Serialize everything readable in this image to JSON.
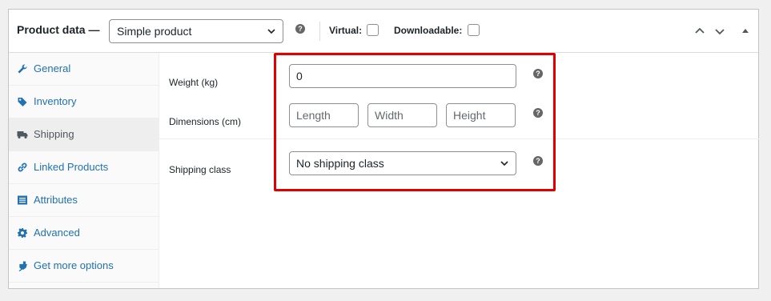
{
  "header": {
    "title": "Product data —",
    "product_type": "Simple product",
    "virtual_label": "Virtual:",
    "downloadable_label": "Downloadable:"
  },
  "help_icon_glyph": "?",
  "tabs": [
    {
      "label": "General",
      "icon": "wrench-icon"
    },
    {
      "label": "Inventory",
      "icon": "tag-icon"
    },
    {
      "label": "Shipping",
      "icon": "truck-icon",
      "active": true
    },
    {
      "label": "Linked Products",
      "icon": "link-icon"
    },
    {
      "label": "Attributes",
      "icon": "list-icon"
    },
    {
      "label": "Advanced",
      "icon": "gear-icon"
    },
    {
      "label": "Get more options",
      "icon": "plugin-icon"
    }
  ],
  "shipping": {
    "weight_label": "Weight (kg)",
    "weight_value": "0",
    "dimensions_label": "Dimensions (cm)",
    "length_placeholder": "Length",
    "width_placeholder": "Width",
    "height_placeholder": "Height",
    "shipping_class_label": "Shipping class",
    "shipping_class_value": "No shipping class"
  },
  "colors": {
    "link": "#2271b1",
    "highlight": "#e00000"
  }
}
